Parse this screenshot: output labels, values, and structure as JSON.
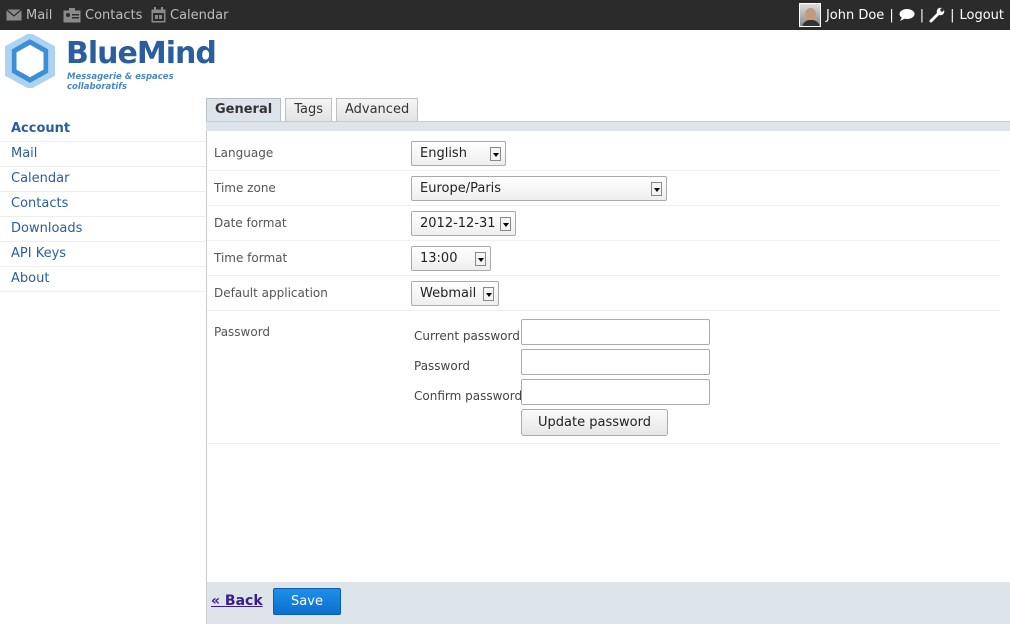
{
  "topbar": {
    "mail": "Mail",
    "contacts": "Contacts",
    "calendar": "Calendar",
    "user_name": "John Doe",
    "sep": "|",
    "logout": "Logout"
  },
  "logo": {
    "name": "BlueMind",
    "tagline": "Messagerie & espaces collaboratifs"
  },
  "sidebar": {
    "items": [
      {
        "label": "Account"
      },
      {
        "label": "Mail"
      },
      {
        "label": "Calendar"
      },
      {
        "label": "Contacts"
      },
      {
        "label": "Downloads"
      },
      {
        "label": "API Keys"
      },
      {
        "label": "About"
      }
    ]
  },
  "tabs": [
    {
      "label": "General"
    },
    {
      "label": "Tags"
    },
    {
      "label": "Advanced"
    }
  ],
  "form": {
    "language": {
      "label": "Language",
      "value": "English"
    },
    "timezone": {
      "label": "Time zone",
      "value": "Europe/Paris"
    },
    "date_format": {
      "label": "Date format",
      "value": "2012-12-31"
    },
    "time_format": {
      "label": "Time format",
      "value": "13:00"
    },
    "default_app": {
      "label": "Default application",
      "value": "Webmail"
    },
    "password": {
      "label": "Password",
      "current": "Current password",
      "new": "Password",
      "confirm": "Confirm password",
      "update_button": "Update password"
    }
  },
  "footer": {
    "back": "« Back",
    "save": "Save"
  }
}
